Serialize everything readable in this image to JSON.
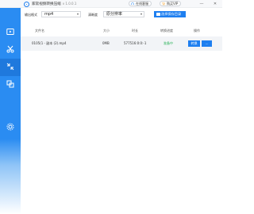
{
  "app": {
    "title": "家软视频转换压缩",
    "version": "v 1.0.0.1"
  },
  "header": {
    "service_label": "在线客服",
    "buy_label": "购买VIP",
    "minimize_glyph": "—",
    "close_glyph": "✕"
  },
  "sidebar": {
    "items": [
      {
        "icon": "video-convert-icon"
      },
      {
        "icon": "cut-icon"
      },
      {
        "icon": "compress-icon"
      },
      {
        "icon": "merge-icon"
      },
      {
        "icon": "settings-icon"
      },
      {
        "icon": "help-icon"
      }
    ]
  },
  "toolbar": {
    "format_label": "输出格式",
    "format_value": "mp4",
    "quality_label": "清晰度",
    "quality_value": "原分辨率",
    "output_dir_button": "选择保存目录"
  },
  "table": {
    "columns": [
      "文件名",
      "大小",
      "时长",
      "转换进度",
      "操作"
    ],
    "rows": [
      {
        "filename": "0105(1 - 副本 (2).mp4",
        "size": "0MB",
        "duration": "577516:0:0:-1",
        "status": "准备中",
        "convert_label": "转换",
        "more_label": "…"
      }
    ]
  },
  "colors": {
    "accent": "#1e7ff0",
    "sidebar": "#2a8cf2",
    "status_ready": "#2bb35a"
  }
}
